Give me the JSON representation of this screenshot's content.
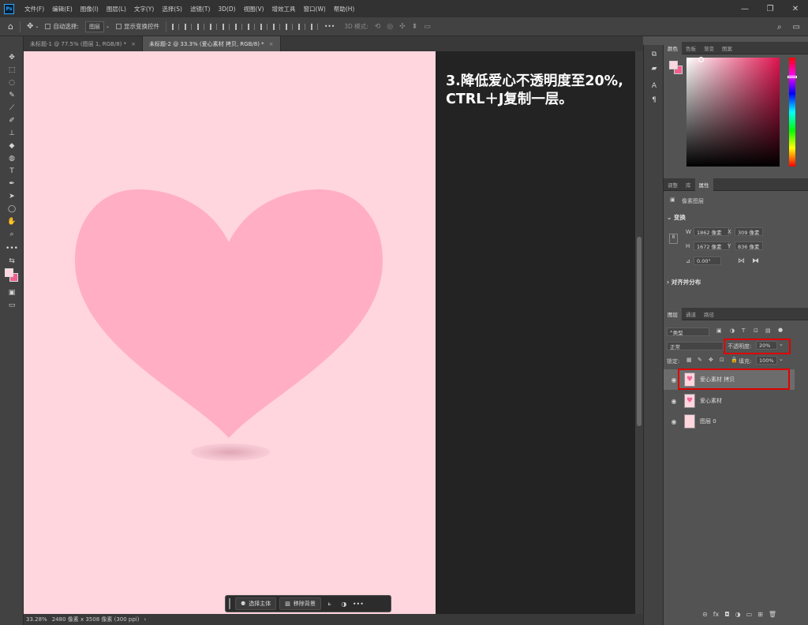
{
  "app": {
    "logo": "Ps",
    "menu": [
      "文件(F)",
      "编辑(E)",
      "图像(I)",
      "图层(L)",
      "文字(Y)",
      "选择(S)",
      "滤镜(T)",
      "3D(D)",
      "视图(V)",
      "增效工具",
      "窗口(W)",
      "帮助(H)"
    ],
    "window_controls": [
      "—",
      "❐",
      "✕"
    ]
  },
  "options": {
    "auto_select_label": "自动选择:",
    "auto_select_value": "图层",
    "show_transform_label": "显示变换控件",
    "mode_3d_label": "3D 模式:"
  },
  "tabs": [
    {
      "label": "未标题-1 @ 77.5% (图层 1, RGB/8) *",
      "close": "×"
    },
    {
      "label": "未标题-2 @ 33.3% (爱心素材 拷贝, RGB/8) *",
      "close": "×"
    }
  ],
  "canvas": {
    "tutorial_line1": "3.降低爱心不透明度至20%,",
    "tutorial_line2": "CTRL＋J复制一层。",
    "heart_color": "#ffaec3",
    "doc_color": "#ffd5de"
  },
  "status": {
    "zoom": "33.28%",
    "doc_size": "2480 像素 x 3508 像素 (300 ppi)",
    "arrow": "›"
  },
  "taskbar": {
    "select_subject": "选择主体",
    "remove_bg": "移除背景",
    "more": "•••"
  },
  "panels": {
    "color_tabs": [
      "颜色",
      "色板",
      "渐变",
      "图案"
    ],
    "props_tabs": [
      "调整",
      "库",
      "属性"
    ],
    "pixel_layer_label": "像素图层",
    "transform_title": "变换",
    "w_label": "W",
    "w_value": "1862 像素",
    "x_label": "X",
    "x_value": "309 像素",
    "h_label": "H",
    "h_value": "1672 像素",
    "y_label": "Y",
    "y_value": "836 像素",
    "angle_value": "0.00°",
    "align_title": "对齐并分布",
    "layers_tabs": [
      "图层",
      "通道",
      "路径"
    ],
    "filter_kind": "类型",
    "blend_mode": "正常",
    "opacity_label": "不透明度:",
    "opacity_value": "20%",
    "lock_label": "锁定:",
    "fill_label": "填充:",
    "fill_value": "100%",
    "layers": [
      {
        "name": "爱心素材 拷贝"
      },
      {
        "name": "爱心素材"
      },
      {
        "name": "图层 0"
      }
    ],
    "bottom_icons": [
      "⊝",
      "fx",
      "◘",
      "◑",
      "▭",
      "⊞",
      "🗑"
    ]
  }
}
